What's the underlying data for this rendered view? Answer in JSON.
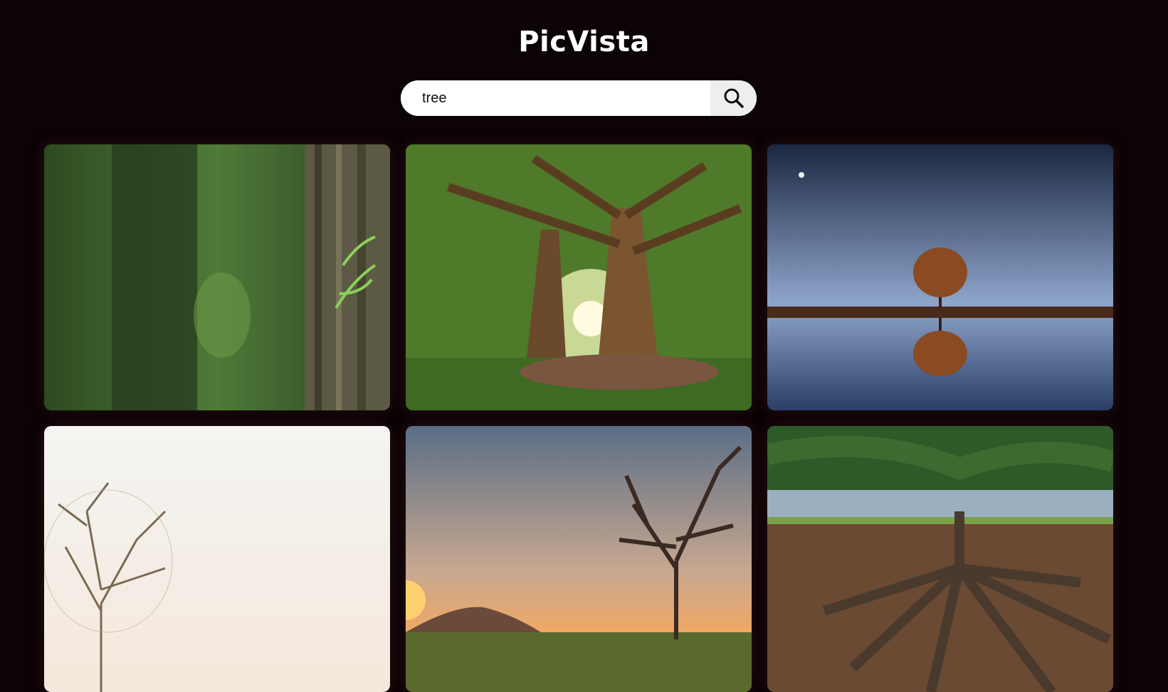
{
  "app": {
    "title": "PicVista"
  },
  "search": {
    "value": "tree",
    "button_icon": "search-icon"
  },
  "gallery": {
    "images": [
      {
        "subject": "tree-bark-closeup"
      },
      {
        "subject": "sunlit-old-trees"
      },
      {
        "subject": "tree-night-reflection"
      },
      {
        "subject": "bare-tree-white-sky"
      },
      {
        "subject": "bare-tree-sunset"
      },
      {
        "subject": "tree-roots-ground"
      }
    ]
  },
  "colors": {
    "background": "#0b0305",
    "title": "#ffffff",
    "search_button": "#eeeeee"
  }
}
